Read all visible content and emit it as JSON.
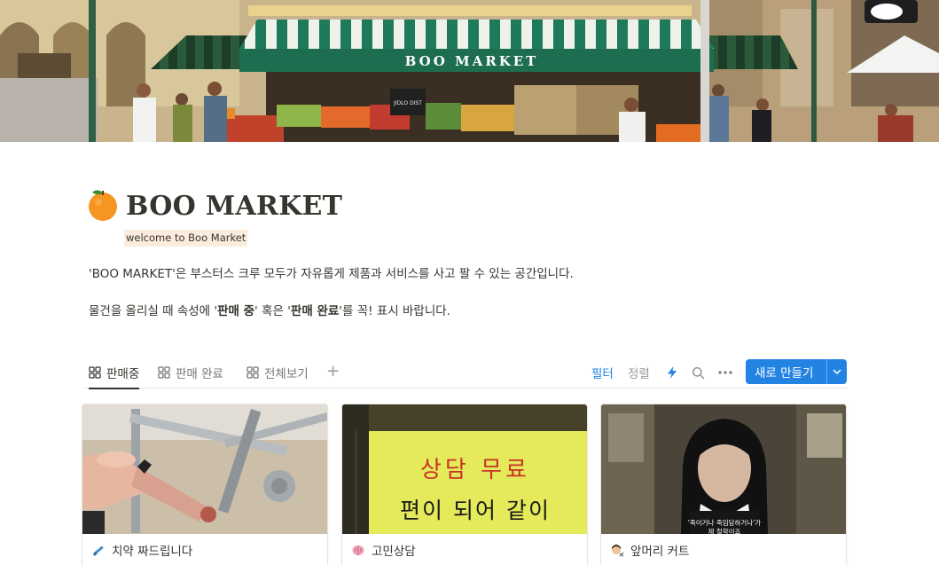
{
  "cover": {
    "market_sign": "BOO MARKET",
    "chalk_sign": "JIDLO DIST"
  },
  "page": {
    "title": "BOO MARKET",
    "subtitle": "welcome to Boo Market",
    "desc_1": "'BOO MARKET'은 부스터스 크루 모두가 자유롭게 제품과 서비스를 사고 팔 수 있는 공간입니다.",
    "desc_2_prefix": "물건을 올리실 때 속성에 '",
    "desc_2_bold_1": "판매 중",
    "desc_2_middle": "' 혹은 '",
    "desc_2_bold_2": "판매 완료",
    "desc_2_suffix": "'를 꼭! 표시 바랍니다."
  },
  "views": {
    "tabs": [
      {
        "label": "판매중",
        "icon": "gallery-icon",
        "active": true
      },
      {
        "label": "판매 완료",
        "icon": "gallery-icon",
        "active": false
      },
      {
        "label": "전체보기",
        "icon": "gallery-icon",
        "active": false
      }
    ],
    "add_view": "+"
  },
  "toolbar": {
    "filter": "필터",
    "sort": "정렬",
    "new_button": "새로 만들기",
    "icons": [
      "lightning-icon",
      "search-icon",
      "more-icon",
      "chevron-down-icon"
    ]
  },
  "colors": {
    "accent": "#2383e2",
    "text": "#37352f",
    "muted": "#787774",
    "subtitle_highlight": "#fbecdd"
  },
  "cards": [
    {
      "title": "치약 짜드립니다",
      "icon": "pencil-tool-icon"
    },
    {
      "title": "고민상담",
      "icon": "brain-icon",
      "image_text_line1": "상담 무료",
      "image_text_line2": "편이 되어 같이"
    },
    {
      "title": "앞머리 커트",
      "icon": "haircut-icon",
      "subtitle_line1": "'죽이거나 죽임당하거나'가",
      "subtitle_line2": "제 철학이죠"
    }
  ]
}
